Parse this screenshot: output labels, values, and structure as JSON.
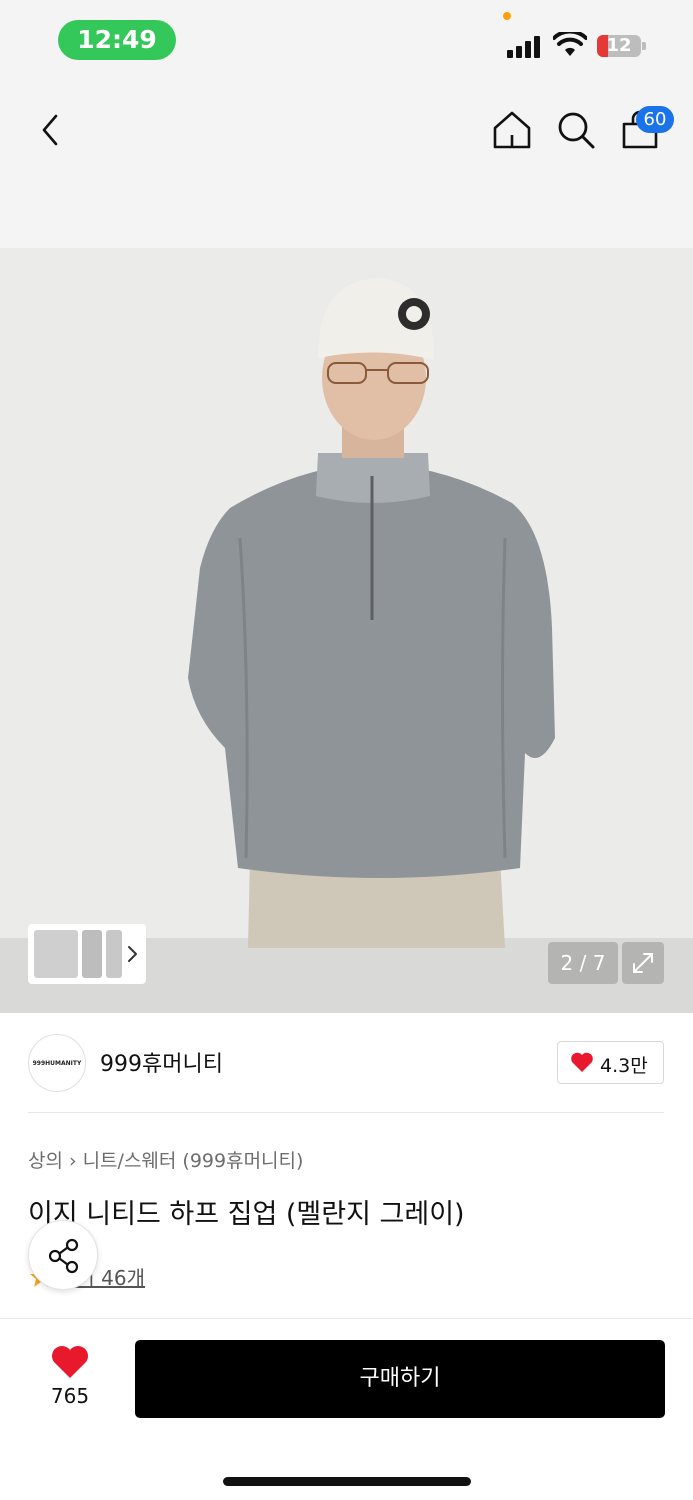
{
  "status_bar": {
    "time": "12:49",
    "battery": "12"
  },
  "nav": {
    "cart_count": "60"
  },
  "gallery": {
    "counter": "2 / 7"
  },
  "brand": {
    "name": "999휴머니티",
    "logo_text": "999HUMANITY",
    "likes": "4.3만"
  },
  "breadcrumb": {
    "items": [
      "상의",
      "니트/스웨터 (999휴머니티)"
    ]
  },
  "product": {
    "title": "이지 니티드 하프 집업 (멜란지 그레이)",
    "reviews_label": "후기 46개"
  },
  "bottom_bar": {
    "like_count": "765",
    "buy_label": "구매하기"
  },
  "colors": {
    "accent_green": "#34c759",
    "badge_blue": "#1a73e8",
    "heart_red": "#e8192c",
    "buy_black": "#000000"
  },
  "icons": [
    "back-icon",
    "home-icon",
    "search-icon",
    "shopping-bag-icon",
    "expand-icon",
    "heart-icon",
    "star-icon",
    "share-icon"
  ]
}
